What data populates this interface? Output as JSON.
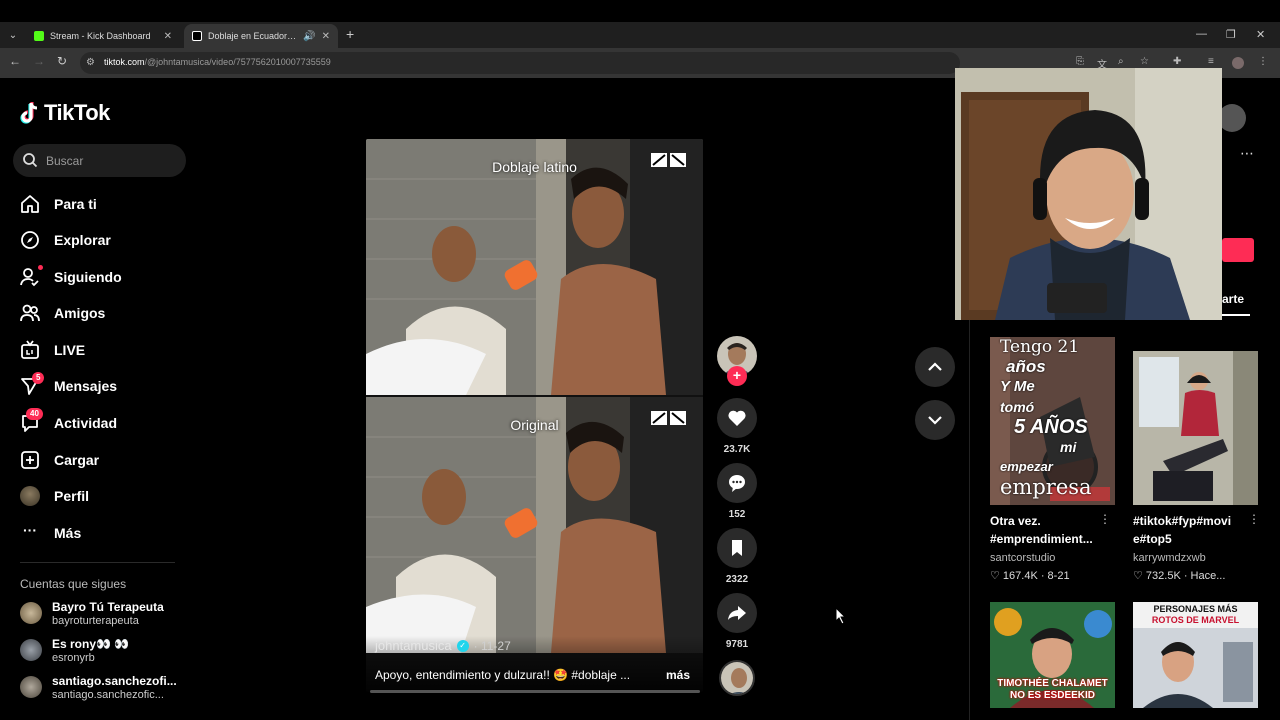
{
  "browser": {
    "tabs": [
      {
        "label": "Stream - Kick Dashboard",
        "favicon_color": "#53fc18"
      },
      {
        "label": "Doblaje en Ecuador: Humor",
        "favicon_color": "#ffffff"
      }
    ],
    "url_host": "tiktok.com",
    "url_path": "/@johntamusica/video/7577562010007735559"
  },
  "sidebar": {
    "logo": "TikTok",
    "search_placeholder": "Buscar",
    "items": [
      {
        "label": "Para ti",
        "icon": "home-icon"
      },
      {
        "label": "Explorar",
        "icon": "compass-icon"
      },
      {
        "label": "Siguiendo",
        "icon": "following-icon"
      },
      {
        "label": "Amigos",
        "icon": "friends-icon"
      },
      {
        "label": "LIVE",
        "icon": "live-icon"
      },
      {
        "label": "Mensajes",
        "icon": "messages-icon",
        "badge": "5"
      },
      {
        "label": "Actividad",
        "icon": "activity-icon",
        "badge": "40"
      },
      {
        "label": "Cargar",
        "icon": "upload-icon"
      },
      {
        "label": "Perfil",
        "icon": "profile-avatar"
      },
      {
        "label": "Más",
        "icon": "more-icon"
      }
    ],
    "following_header": "Cuentas que sigues",
    "accounts": [
      {
        "name": "Bayro Tú Terapeuta",
        "handle": "bayroturterapeuta"
      },
      {
        "name": "Es rony👀 👀",
        "handle": "esronyrb"
      },
      {
        "name": "santiago.sanchezofi...",
        "handle": "santiago.sanchezofic..."
      }
    ]
  },
  "video": {
    "top_label": "Doblaje latino",
    "bottom_label": "Original",
    "author": "johntamusica",
    "date": "11-27",
    "caption": "Apoyo, entendimiento y dulzura!! 🤩 #doblaje ...",
    "more_label": "más",
    "likes": "23.7K",
    "comments": "152",
    "saves": "2322",
    "shares": "9781"
  },
  "related": [
    {
      "thumb_lines": [
        "Tengo 21",
        "años",
        "Y Me",
        "tomó",
        "5 AÑOS",
        "mi",
        "empezar",
        "empresa"
      ],
      "title": "Otra vez. #emprendimient...",
      "author": "santcorstudio",
      "stats": "♡ 167.4K · 8-21"
    },
    {
      "title": "#tiktok#fyp#movi e#top5",
      "author": "karrywmdzxwb",
      "stats": "♡ 732.5K · Hace..."
    },
    {
      "thumb_lines": [
        "TIMOTHÉE CHALAMET",
        "NO ES ESDEEKID"
      ],
      "title": "",
      "author": "",
      "stats": ""
    },
    {
      "thumb_lines": [
        "PERSONAJES MÁS",
        "ROTOS DE MARVEL"
      ],
      "title": "",
      "author": "",
      "stats": ""
    }
  ],
  "right_panel": {
    "tab_label": "arte"
  },
  "colors": {
    "accent": "#fe2c55",
    "verified": "#20d5ec"
  }
}
